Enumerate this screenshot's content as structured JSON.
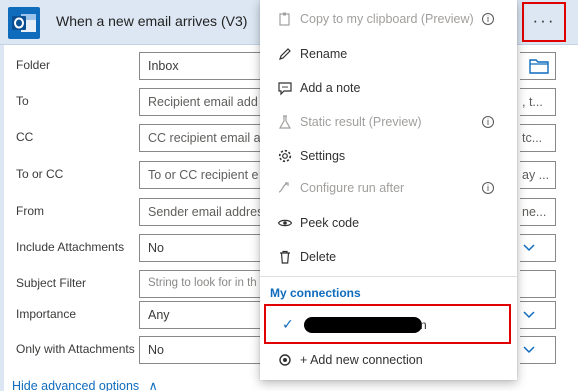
{
  "card": {
    "title": "When a new email arrives (V3)",
    "more_label": "···",
    "fields": [
      {
        "label": "Folder",
        "value": "Inbox",
        "right": ""
      },
      {
        "label": "To",
        "value": "Recipient email add",
        "right": ", t..."
      },
      {
        "label": "CC",
        "value": "CC recipient email a",
        "right": "tc..."
      },
      {
        "label": "To or CC",
        "value": "To or CC recipient e",
        "right": "ay ..."
      },
      {
        "label": "From",
        "value": "Sender email addres",
        "right": "ne..."
      },
      {
        "label": "Include Attachments",
        "value": "No",
        "right": ""
      },
      {
        "label": "Subject Filter",
        "value": "String to look for in th",
        "right": ""
      },
      {
        "label": "Importance",
        "value": "Any",
        "right": ""
      },
      {
        "label": "Only with Attachments",
        "value": "No",
        "right": ""
      }
    ],
    "advanced_link": "Hide advanced options",
    "advanced_chevron": "∧"
  },
  "menu": {
    "items": [
      {
        "label": "Copy to my clipboard (Preview)",
        "icon": "clipboard-icon",
        "disabled": true,
        "info": true
      },
      {
        "label": "Rename",
        "icon": "pencil-icon",
        "disabled": false,
        "info": false
      },
      {
        "label": "Add a note",
        "icon": "note-icon",
        "disabled": false,
        "info": false
      },
      {
        "label": "Static result (Preview)",
        "icon": "flask-icon",
        "disabled": true,
        "info": true
      },
      {
        "label": "Settings",
        "icon": "gear-icon",
        "disabled": false,
        "info": false
      },
      {
        "label": "Configure run after",
        "icon": "run-after-icon",
        "disabled": true,
        "info": true
      },
      {
        "label": "Peek code",
        "icon": "eye-icon",
        "disabled": false,
        "info": false
      },
      {
        "label": "Delete",
        "icon": "trash-icon",
        "disabled": false,
        "info": false
      }
    ],
    "info_glyph": "i",
    "connections_title": "My connections",
    "connection_suffix": "n",
    "check_glyph": "✓",
    "add_connection_label": "+ Add new connection"
  },
  "colors": {
    "accent": "#0f6cbd",
    "header_bg": "#dce7f3",
    "highlight_border": "#e00000"
  }
}
